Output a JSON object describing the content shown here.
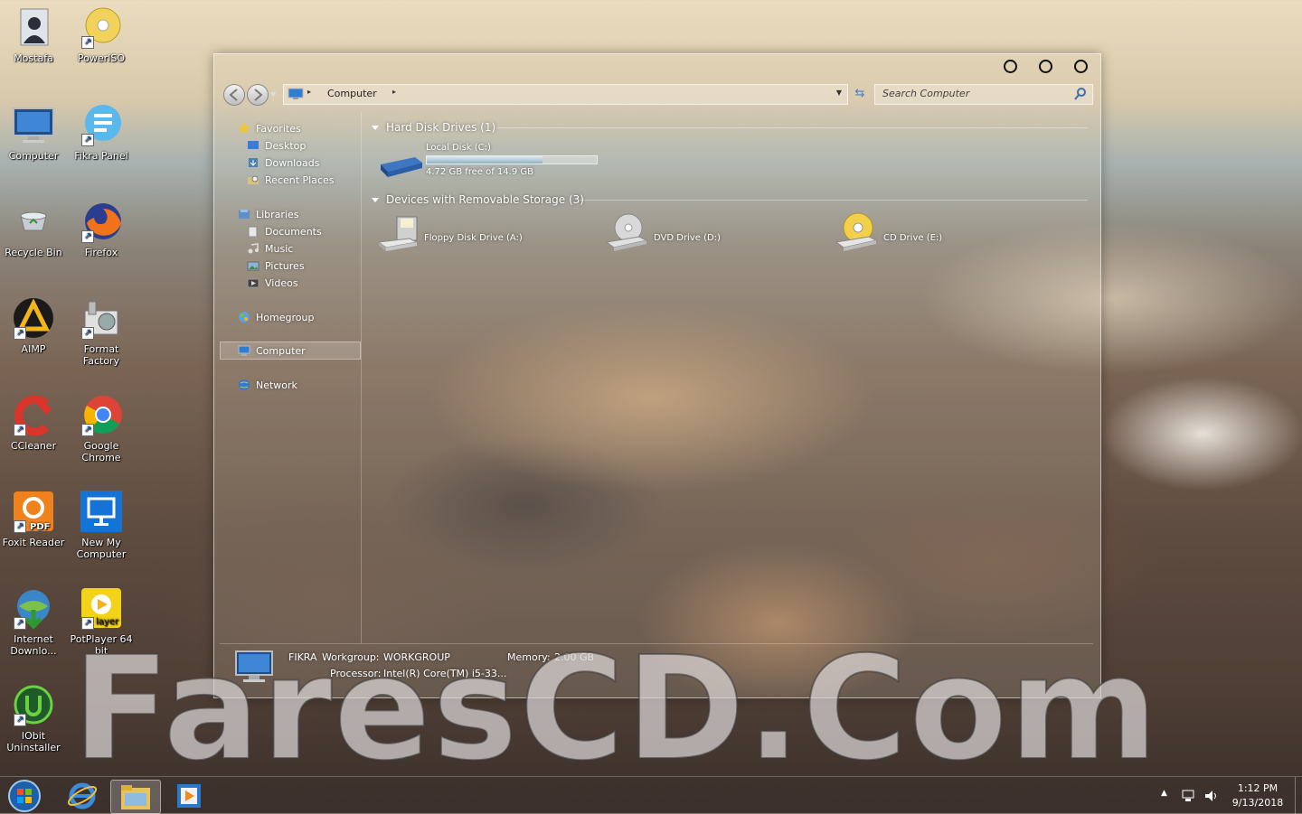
{
  "desktop_icons": [
    {
      "label": "Mostafa"
    },
    {
      "label": "PowerISO"
    },
    {
      "label": "Computer"
    },
    {
      "label": "Fikra Panel"
    },
    {
      "label": "Recycle Bin"
    },
    {
      "label": "Firefox"
    },
    {
      "label": "AIMP"
    },
    {
      "label": "Format Factory"
    },
    {
      "label": "CCleaner"
    },
    {
      "label": "Google Chrome"
    },
    {
      "label": "Foxit Reader"
    },
    {
      "label": "New My Computer"
    },
    {
      "label": "Internet Downlo..."
    },
    {
      "label": "PotPlayer 64 bit"
    },
    {
      "label": "IObit Uninstaller"
    }
  ],
  "window": {
    "address": {
      "location": "Computer"
    },
    "search": {
      "placeholder": "Search Computer"
    },
    "sidebar": {
      "favorites": "Favorites",
      "desktop": "Desktop",
      "downloads": "Downloads",
      "recent": "Recent Places",
      "libraries": "Libraries",
      "documents": "Documents",
      "music": "Music",
      "pictures": "Pictures",
      "videos": "Videos",
      "homegroup": "Homegroup",
      "computer": "Computer",
      "network": "Network"
    },
    "content": {
      "hdd_group": "Hard Disk Drives (1)",
      "removable_group": "Devices with Removable Storage (3)",
      "local_disk": {
        "name": "Local Disk (C:)",
        "free": "4.72 GB free of 14.9 GB",
        "used_fraction": 0.683
      },
      "floppy": "Floppy Disk Drive (A:)",
      "dvd": "DVD Drive (D:)",
      "cd": "CD Drive (E:)"
    },
    "details": {
      "name": "FIKRA",
      "workgroup_label": "Workgroup:",
      "workgroup": "WORKGROUP",
      "memory_label": "Memory:",
      "memory": "2.00 GB",
      "processor_label": "Processor:",
      "processor": "Intel(R) Core(TM) i5-33..."
    }
  },
  "watermark": "FaresCD.Com",
  "taskbar": {
    "time": "1:12 PM",
    "date": "9/13/2018"
  }
}
